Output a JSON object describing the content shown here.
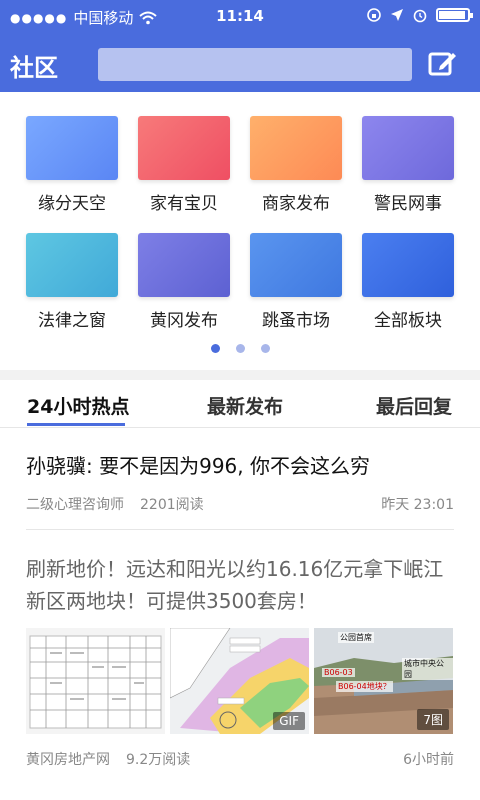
{
  "status_bar": {
    "carrier": "中国移动",
    "time": "11:14",
    "icons": [
      "signal-dots-icon",
      "wifi-icon",
      "rotation-lock-icon",
      "location-arrow-icon",
      "alarm-icon",
      "battery-icon"
    ]
  },
  "top_bar": {
    "title": "社区",
    "search_placeholder": "",
    "compose_icon": "compose-edit-icon"
  },
  "categories": [
    {
      "label": "缘分天空",
      "color": "#6f9bff"
    },
    {
      "label": "家有宝贝",
      "color": "#f4606b"
    },
    {
      "label": "商家发布",
      "color": "#ff9a5c"
    },
    {
      "label": "警民网事",
      "color": "#7b77e3"
    },
    {
      "label": "法律之窗",
      "color": "#4fb9dd"
    },
    {
      "label": "黄冈发布",
      "color": "#6e73dc"
    },
    {
      "label": "跳蚤市场",
      "color": "#4e86e6"
    },
    {
      "label": "全部板块",
      "color": "#3d6ee3"
    }
  ],
  "pager": {
    "count": 3,
    "active_index": 0
  },
  "tabs": [
    {
      "label": "24小时热点",
      "active": true
    },
    {
      "label": "最新发布",
      "active": false
    },
    {
      "label": "最后回复",
      "active": false
    }
  ],
  "articles": [
    {
      "title": "孙骁骥: 要不是因为996, 你不会这么穷",
      "author": "二级心理咨询师",
      "reads": "2201阅读",
      "time": "昨天 23:01"
    },
    {
      "title_line1": "刷新地价！远达和阳光以约16.16亿元拿下岷江",
      "title_line2": "新区两地块！可提供3500套房！",
      "author": "黄冈房地产网",
      "reads": "9.2万阅读",
      "time": "6小时前",
      "images": [
        {
          "badge": ""
        },
        {
          "badge": "GIF"
        },
        {
          "badge": "7图",
          "labels": [
            "公园首席",
            "B06-03",
            "B06-04地块？",
            "城市中央公园"
          ]
        }
      ]
    }
  ],
  "colors": {
    "brand": "#4a6cdd",
    "search": "#b6c2f0"
  }
}
